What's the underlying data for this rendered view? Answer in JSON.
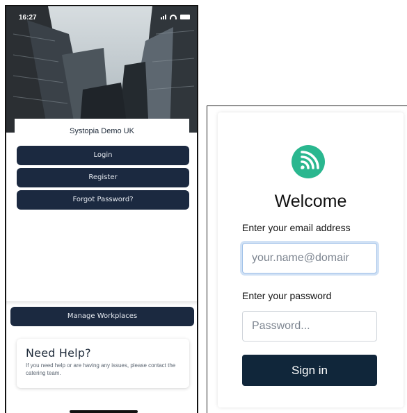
{
  "phone": {
    "status_time": "16:27",
    "org_name": "Systopia Demo UK",
    "buttons": {
      "login": "Login",
      "register": "Register",
      "forgot": "Forgot Password?",
      "manage": "Manage Workplaces"
    },
    "help": {
      "title": "Need Help?",
      "text": "If you need help or are having any issues, please contact the catering team."
    }
  },
  "login_card": {
    "title": "Welcome",
    "email_label": "Enter your email address",
    "email_placeholder": "your.name@domair",
    "password_label": "Enter your password",
    "password_placeholder": "Password...",
    "signin_label": "Sign in",
    "logo_icon": "feed-icon",
    "accent_color": "#2ab78f",
    "button_color": "#10263a"
  }
}
